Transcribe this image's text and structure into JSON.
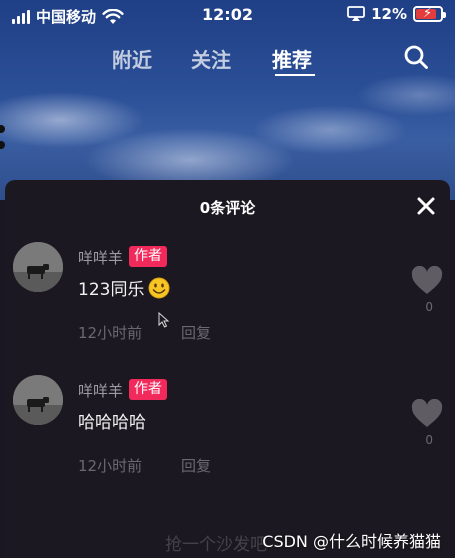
{
  "status_bar": {
    "carrier": "中国移动",
    "time": "12:02",
    "battery_percent": "12%",
    "battery_level": 0.12
  },
  "top_nav": {
    "tabs": [
      {
        "label": "附近",
        "active": false
      },
      {
        "label": "关注",
        "active": false
      },
      {
        "label": "推荐",
        "active": true
      }
    ],
    "search_icon": "search-icon"
  },
  "comments_panel": {
    "title": "0条评论",
    "close_icon": "close-icon",
    "comments": [
      {
        "username": "咩咩羊",
        "badge": "作者",
        "text": "123同乐",
        "emoji": "smile-emoji",
        "time": "12小时前",
        "reply_label": "回复",
        "like_count": "0"
      },
      {
        "username": "咩咩羊",
        "badge": "作者",
        "text": "哈哈哈哈",
        "time": "12小时前",
        "reply_label": "回复",
        "like_count": "0"
      }
    ],
    "input_placeholder": "抢一个沙发吧"
  },
  "watermark": "CSDN @什么时候养猫猫",
  "colors": {
    "badge": "#f2295b",
    "panel_bg": "#1c1821",
    "meta_text": "#6b6870",
    "like_icon": "#5f5c63"
  }
}
